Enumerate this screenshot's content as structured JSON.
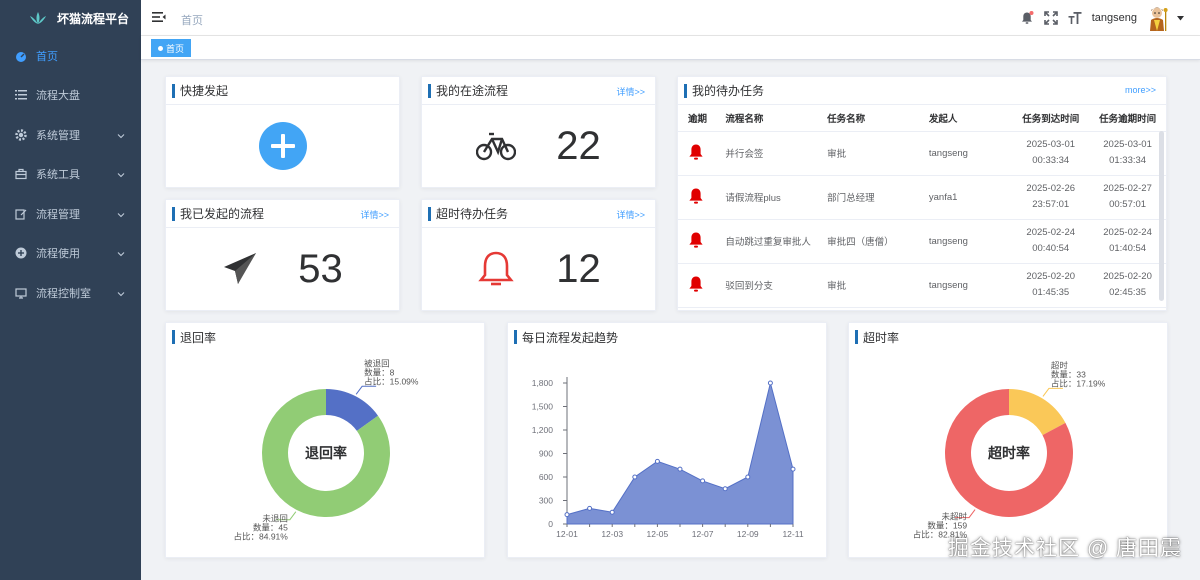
{
  "app": {
    "title": "坏猫流程平台"
  },
  "sidebar": {
    "items": [
      {
        "label": "首页",
        "icon": "dashboard-icon",
        "active": true
      },
      {
        "label": "流程大盘",
        "icon": "list-icon"
      },
      {
        "label": "系统管理",
        "icon": "gear-icon",
        "expandable": true
      },
      {
        "label": "系统工具",
        "icon": "toolbox-icon",
        "expandable": true
      },
      {
        "label": "流程管理",
        "icon": "edit-icon",
        "expandable": true
      },
      {
        "label": "流程使用",
        "icon": "circle-plus-icon",
        "expandable": true
      },
      {
        "label": "流程控制室",
        "icon": "monitor-icon",
        "expandable": true
      }
    ]
  },
  "header": {
    "breadcrumb": "首页",
    "username": "tangseng"
  },
  "tags": [
    {
      "label": "首页"
    }
  ],
  "cards": {
    "quick_start": {
      "title": "快捷发起"
    },
    "in_progress": {
      "title": "我的在途流程",
      "more": "详情>>",
      "value": "22"
    },
    "initiated": {
      "title": "我已发起的流程",
      "more": "详情>>",
      "value": "53"
    },
    "overdue": {
      "title": "超时待办任务",
      "more": "详情>>",
      "value": "12"
    },
    "todo": {
      "title": "我的待办任务",
      "more": "more>>",
      "columns": [
        "逾期",
        "流程名称",
        "任务名称",
        "发起人",
        "任务到达时间",
        "任务逾期时间"
      ],
      "rows": [
        {
          "process": "并行会签",
          "task": "审批",
          "initiator": "tangseng",
          "arrive": [
            "2025-03-01",
            "00:33:34"
          ],
          "due": [
            "2025-03-01",
            "01:33:34"
          ]
        },
        {
          "process": "请假流程plus",
          "task": "部门总经理",
          "initiator": "yanfa1",
          "arrive": [
            "2025-02-26",
            "23:57:01"
          ],
          "due": [
            "2025-02-27",
            "00:57:01"
          ]
        },
        {
          "process": "自动跳过重复审批人",
          "task": "审批四（唐僧）",
          "initiator": "tangseng",
          "arrive": [
            "2025-02-24",
            "00:40:54"
          ],
          "due": [
            "2025-02-24",
            "01:40:54"
          ]
        },
        {
          "process": "驳回到分支",
          "task": "审批",
          "initiator": "tangseng",
          "arrive": [
            "2025-02-20",
            "01:45:35"
          ],
          "due": [
            "2025-02-20",
            "02:45:35"
          ]
        }
      ]
    }
  },
  "colors": {
    "sidebar": "#304156",
    "accent": "#409eff",
    "alarm": "#e53935",
    "quick": "#42a5f5",
    "return_yes": "#5470c6",
    "return_no": "#91cc75",
    "timeout_yes": "#fac858",
    "timeout_no": "#ee6666",
    "area": "#7b91d4"
  },
  "charts": {
    "return_rate": {
      "title": "退回率"
    },
    "daily_trend": {
      "title": "每日流程发起趋势"
    },
    "timeout_rate": {
      "title": "超时率"
    }
  },
  "chart_data": [
    {
      "type": "pie",
      "title": "退回率",
      "center_label": "退回率",
      "slices": [
        {
          "name": "被退回",
          "value": 8,
          "percent": "15.09%",
          "label_count": "数量：8",
          "label_pct": "占比：15.09%"
        },
        {
          "name": "未退回",
          "value": 45,
          "percent": "84.91%",
          "label_count": "数量：45",
          "label_pct": "占比：84.91%"
        }
      ]
    },
    {
      "type": "area",
      "title": "每日流程发起趋势",
      "x": [
        "12-01",
        "12-02",
        "12-03",
        "12-04",
        "12-05",
        "12-06",
        "12-07",
        "12-08",
        "12-09",
        "12-10",
        "12-11"
      ],
      "x_tick_labels": [
        "12-01",
        "12-03",
        "12-05",
        "12-07",
        "12-09",
        "12-11"
      ],
      "values": [
        120,
        200,
        150,
        600,
        800,
        700,
        550,
        450,
        600,
        1800,
        700
      ],
      "ylim": [
        0,
        1800
      ],
      "yticks": [
        "0",
        "300",
        "600",
        "900",
        "1,200",
        "1,500",
        "1,800"
      ]
    },
    {
      "type": "pie",
      "title": "超时率",
      "center_label": "超时率",
      "slices": [
        {
          "name": "超时",
          "value": 33,
          "percent": "17.19%",
          "label_count": "数量：33",
          "label_pct": "占比：17.19%"
        },
        {
          "name": "未超时",
          "value": 159,
          "percent": "82.81%",
          "label_count": "数量：159",
          "label_pct": "占比：82.81%"
        }
      ]
    }
  ],
  "watermark": "掘金技术社区 @ 唐田震"
}
